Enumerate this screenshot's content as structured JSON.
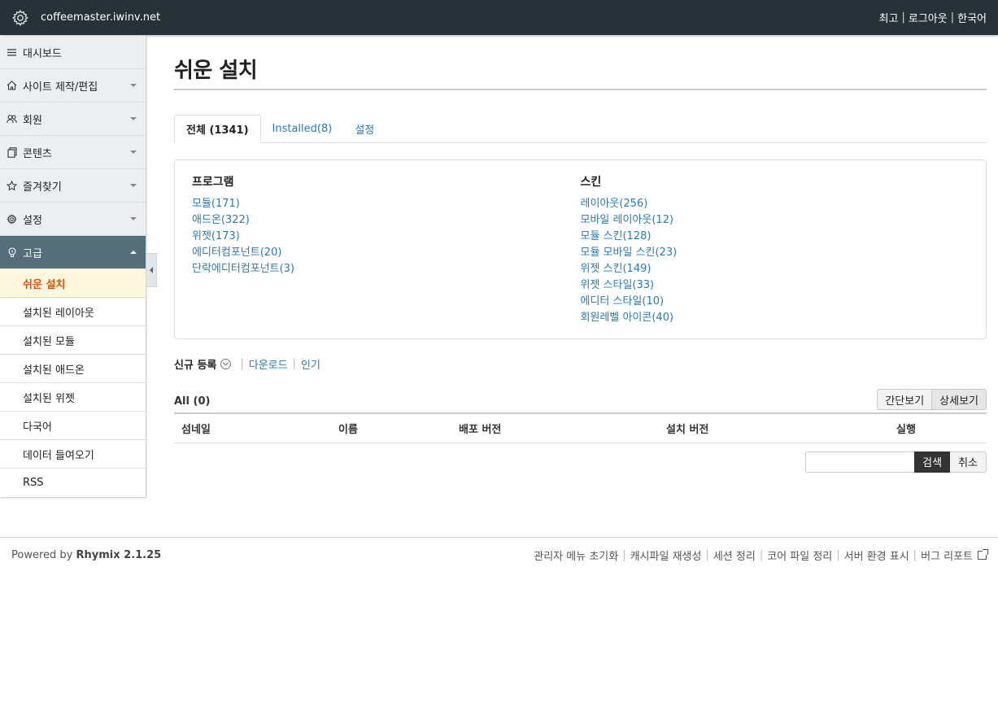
{
  "header": {
    "site_name": "coffeemaster.iwinv.net",
    "links": [
      "최고",
      "로그아웃",
      "한국어"
    ],
    "separator": "|"
  },
  "sidebar": {
    "items": [
      {
        "label": "대시보드",
        "icon": "menu-icon"
      },
      {
        "label": "사이트 제작/편집",
        "icon": "home-icon"
      },
      {
        "label": "회원",
        "icon": "users-icon"
      },
      {
        "label": "콘텐츠",
        "icon": "documents-icon"
      },
      {
        "label": "즐겨찾기",
        "icon": "star-icon"
      },
      {
        "label": "설정",
        "icon": "gear-icon"
      },
      {
        "label": "고급",
        "icon": "lightbulb-icon"
      }
    ],
    "sub_items": [
      "쉬운 설치",
      "설치된 레이아웃",
      "설치된 모듈",
      "설치된 애드온",
      "설치된 위젯",
      "다국어",
      "데이터 들여오기",
      "RSS"
    ]
  },
  "main": {
    "title": "쉬운 설치",
    "tabs": [
      "전체 (1341)",
      "Installed(8)",
      "설정"
    ],
    "program": {
      "heading": "프로그램",
      "links": [
        "모듈(171)",
        "애드온(322)",
        "위젯(173)",
        "에디터컴포넌트(20)",
        "단락에디터컴포넌트(3)"
      ]
    },
    "skin": {
      "heading": "스킨",
      "links": [
        "레이아웃(256)",
        "모바일 레이아웃(12)",
        "모듈 스킨(128)",
        "모듈 모바일 스킨(23)",
        "위젯 스킨(149)",
        "위젯 스타일(33)",
        "에디터 스타일(10)",
        "회원레벨 아이콘(40)"
      ]
    },
    "sort": {
      "current": "신규 등록",
      "options": [
        "다운로드",
        "인기"
      ],
      "separator": "|"
    },
    "list_count": "All (0)",
    "view_buttons": [
      "간단보기",
      "상세보기"
    ],
    "table_headers": [
      "섬네일",
      "이름",
      "배포 버전",
      "설치 버전",
      "실행"
    ],
    "search_button": "검색",
    "cancel_button": "취소"
  },
  "footer": {
    "powered_prefix": "Powered by",
    "powered_name": "Rhymix 2.1.25",
    "links": [
      "관리자 메뉴 초기화",
      "캐시파일 재생성",
      "세션 정리",
      "코어 파일 정리",
      "서버 환경 표시",
      "버그 리포트"
    ],
    "separator": "|"
  },
  "colors": {
    "header_bg": "#263238",
    "active_menu_bg": "#546e7a",
    "current_sub_bg": "#fff8e1",
    "current_sub_text": "#e65100",
    "link": "#2a7ab8"
  }
}
